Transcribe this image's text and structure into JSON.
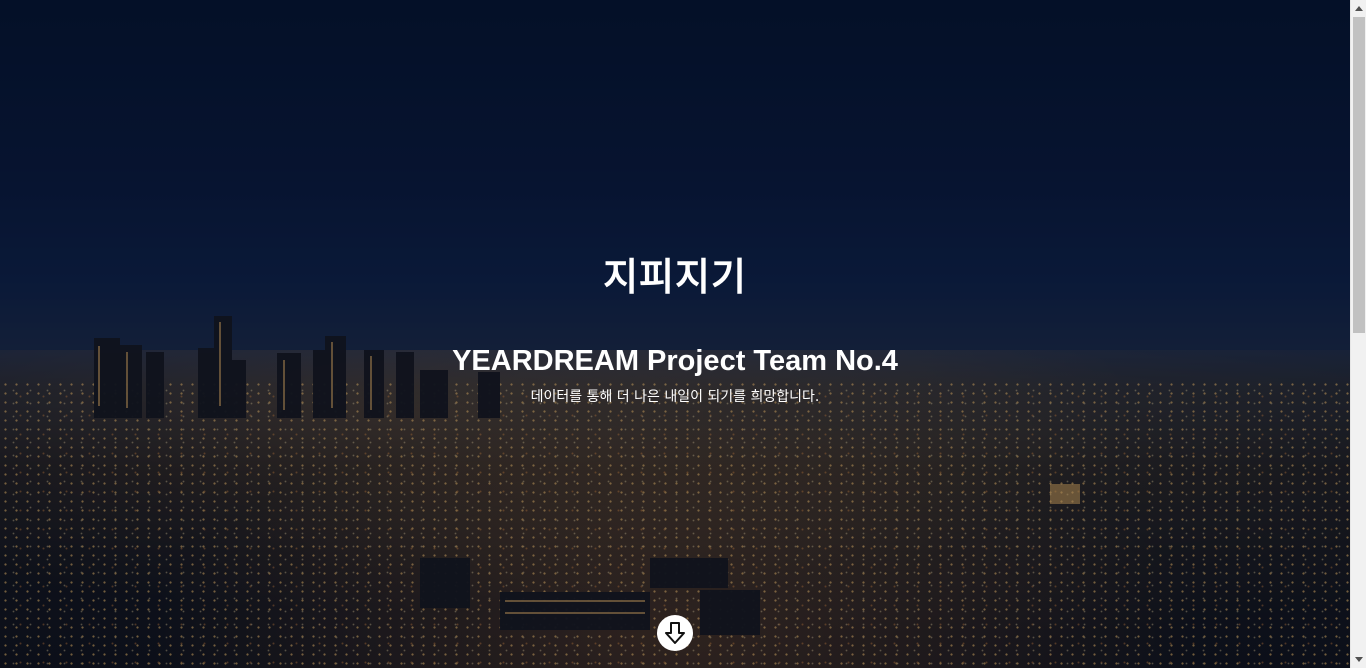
{
  "hero": {
    "title": "지피지기",
    "subtitle": "YEARDREAM Project Team No.4",
    "tagline": "데이터를 통해 더 나은 내일이 되기를 희망합니다.",
    "scroll_icon": "arrow-down-circle-icon"
  },
  "colors": {
    "sky": "#0b1a33",
    "text": "#ffffff",
    "scroll_button": "#ffffff",
    "scrollbar_track": "#f1f1f1",
    "scrollbar_thumb": "#c1c1c1"
  }
}
